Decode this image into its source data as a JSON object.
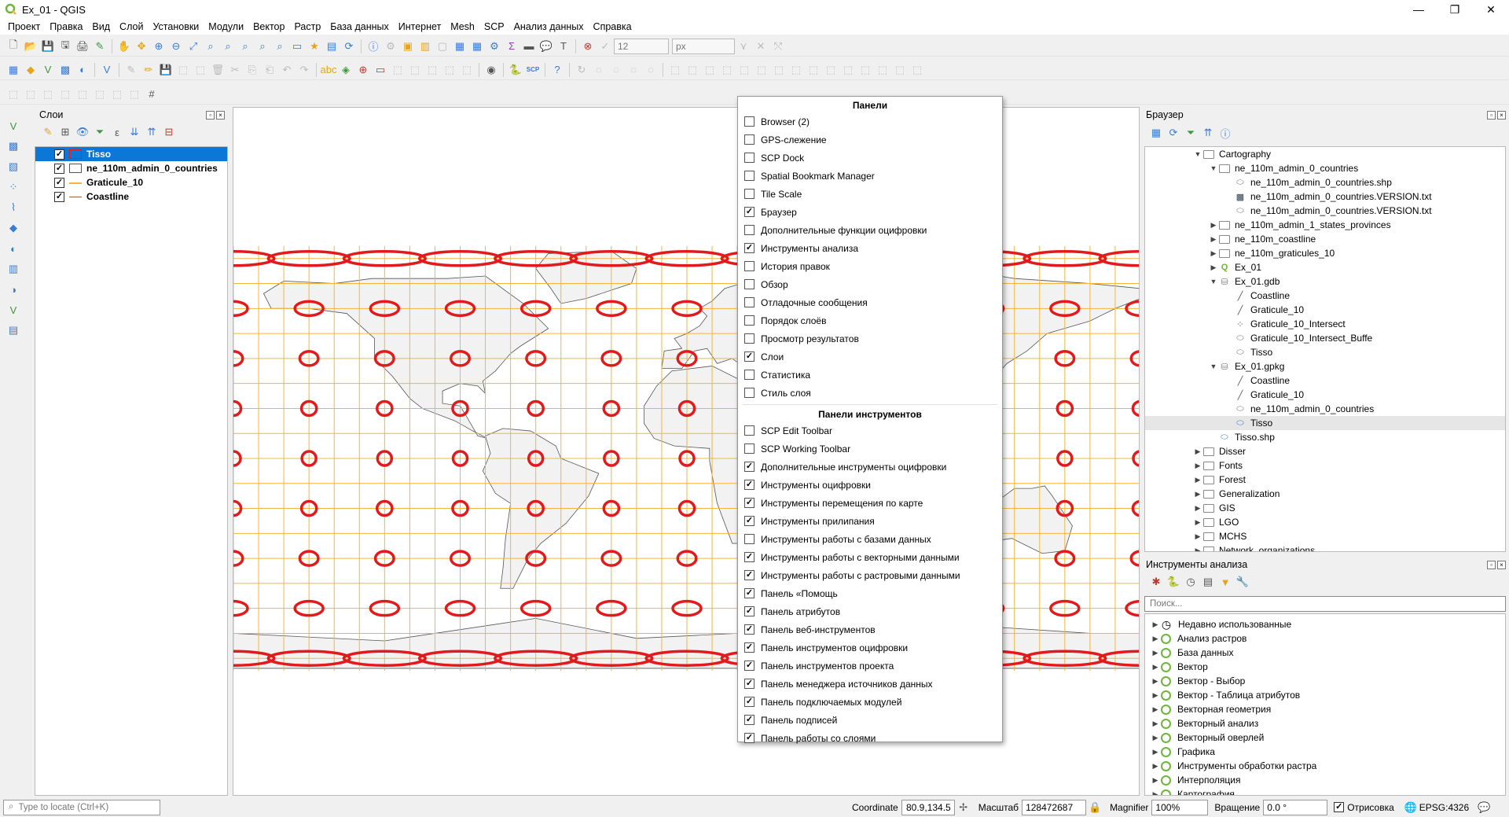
{
  "window": {
    "title": "Ex_01 - QGIS",
    "minimize": "—",
    "maximize": "❐",
    "close": "✕"
  },
  "menu": [
    "Проект",
    "Правка",
    "Вид",
    "Слой",
    "Установки",
    "Модули",
    "Вектор",
    "Растр",
    "База данных",
    "Интернет",
    "Mesh",
    "SCP",
    "Анализ данных",
    "Справка"
  ],
  "toolbar": {
    "size_value": "12",
    "unit_value": "px"
  },
  "layers_panel": {
    "title": "Слои",
    "items": [
      {
        "name": "Tisso",
        "checked": true,
        "selected": true
      },
      {
        "name": "ne_110m_admin_0_countries",
        "checked": true,
        "selected": false
      },
      {
        "name": "Graticule_10",
        "checked": true,
        "selected": false
      },
      {
        "name": "Coastline",
        "checked": true,
        "selected": false
      }
    ]
  },
  "popup": {
    "section_panels": "Панели",
    "panels": [
      {
        "label": "Browser (2)",
        "checked": false
      },
      {
        "label": "GPS-слежение",
        "checked": false
      },
      {
        "label": "SCP Dock",
        "checked": false
      },
      {
        "label": "Spatial Bookmark Manager",
        "checked": false
      },
      {
        "label": "Tile Scale",
        "checked": false
      },
      {
        "label": "Браузер",
        "checked": true
      },
      {
        "label": "Дополнительные функции оцифровки",
        "checked": false
      },
      {
        "label": "Инструменты анализа",
        "checked": true
      },
      {
        "label": "История правок",
        "checked": false
      },
      {
        "label": "Обзор",
        "checked": false
      },
      {
        "label": "Отладочные сообщения",
        "checked": false
      },
      {
        "label": "Порядок слоёв",
        "checked": false
      },
      {
        "label": "Просмотр результатов",
        "checked": false
      },
      {
        "label": "Слои",
        "checked": true
      },
      {
        "label": "Статистика",
        "checked": false
      },
      {
        "label": "Стиль слоя",
        "checked": false
      }
    ],
    "section_toolbars": "Панели инструментов",
    "toolbars": [
      {
        "label": "SCP Edit Toolbar",
        "checked": false
      },
      {
        "label": "SCP Working Toolbar",
        "checked": false
      },
      {
        "label": "Дополнительные инструменты оцифровки",
        "checked": true
      },
      {
        "label": "Инструменты оцифровки",
        "checked": true
      },
      {
        "label": "Инструменты перемещения по карте",
        "checked": true
      },
      {
        "label": "Инструменты прилипания",
        "checked": true
      },
      {
        "label": "Инструменты работы с базами данных",
        "checked": false
      },
      {
        "label": "Инструменты работы с векторными данными",
        "checked": true
      },
      {
        "label": "Инструменты работы с растровыми данными",
        "checked": true
      },
      {
        "label": "Панель «Помощь",
        "checked": true
      },
      {
        "label": "Панель атрибутов",
        "checked": true
      },
      {
        "label": "Панель веб-инструментов",
        "checked": true
      },
      {
        "label": "Панель инструментов оцифровки",
        "checked": true
      },
      {
        "label": "Панель инструментов проекта",
        "checked": true
      },
      {
        "label": "Панель менеджера источников данных",
        "checked": true
      },
      {
        "label": "Панель подключаемых модулей",
        "checked": true
      },
      {
        "label": "Панель подписей",
        "checked": true
      },
      {
        "label": "Панель работы со слоями",
        "checked": true
      }
    ]
  },
  "browser_panel": {
    "title": "Браузер",
    "items": [
      {
        "level": 3,
        "arrow": "▼",
        "icon": "folder",
        "label": "Cartography"
      },
      {
        "level": 4,
        "arrow": "▼",
        "icon": "folder",
        "label": "ne_110m_admin_0_countries"
      },
      {
        "level": 5,
        "arrow": "",
        "icon": "polygon",
        "label": "ne_110m_admin_0_countries.shp"
      },
      {
        "level": 5,
        "arrow": "",
        "icon": "raster",
        "label": "ne_110m_admin_0_countries.VERSION.txt"
      },
      {
        "level": 5,
        "arrow": "",
        "icon": "polygon",
        "label": "ne_110m_admin_0_countries.VERSION.txt"
      },
      {
        "level": 4,
        "arrow": "▶",
        "icon": "folder",
        "label": "ne_110m_admin_1_states_provinces"
      },
      {
        "level": 4,
        "arrow": "▶",
        "icon": "folder",
        "label": "ne_110m_coastline"
      },
      {
        "level": 4,
        "arrow": "▶",
        "icon": "folder",
        "label": "ne_110m_graticules_10"
      },
      {
        "level": 4,
        "arrow": "▶",
        "icon": "qgis",
        "label": "Ex_01"
      },
      {
        "level": 4,
        "arrow": "▼",
        "icon": "db",
        "label": "Ex_01.gdb"
      },
      {
        "level": 5,
        "arrow": "",
        "icon": "line",
        "label": "Coastline"
      },
      {
        "level": 5,
        "arrow": "",
        "icon": "line",
        "label": "Graticule_10"
      },
      {
        "level": 5,
        "arrow": "",
        "icon": "point",
        "label": "Graticule_10_Intersect"
      },
      {
        "level": 5,
        "arrow": "",
        "icon": "polygon",
        "label": "Graticule_10_Intersect_Buffe"
      },
      {
        "level": 5,
        "arrow": "",
        "icon": "polygon",
        "label": "Tisso"
      },
      {
        "level": 4,
        "arrow": "▼",
        "icon": "db",
        "label": "Ex_01.gpkg"
      },
      {
        "level": 5,
        "arrow": "",
        "icon": "line",
        "label": "Coastline"
      },
      {
        "level": 5,
        "arrow": "",
        "icon": "line",
        "label": "Graticule_10"
      },
      {
        "level": 5,
        "arrow": "",
        "icon": "polygon",
        "label": "ne_110m_admin_0_countries"
      },
      {
        "level": 5,
        "arrow": "",
        "icon": "polygon-blue",
        "label": "Tisso",
        "selected": true
      },
      {
        "level": 4,
        "arrow": "",
        "icon": "polygon-blue",
        "label": "Tisso.shp"
      },
      {
        "level": 3,
        "arrow": "▶",
        "icon": "folder",
        "label": "Disser"
      },
      {
        "level": 3,
        "arrow": "▶",
        "icon": "folder",
        "label": "Fonts"
      },
      {
        "level": 3,
        "arrow": "▶",
        "icon": "folder",
        "label": "Forest"
      },
      {
        "level": 3,
        "arrow": "▶",
        "icon": "folder",
        "label": "Generalization"
      },
      {
        "level": 3,
        "arrow": "▶",
        "icon": "folder",
        "label": "GIS"
      },
      {
        "level": 3,
        "arrow": "▶",
        "icon": "folder",
        "label": "LGO"
      },
      {
        "level": 3,
        "arrow": "▶",
        "icon": "folder",
        "label": "MCHS"
      },
      {
        "level": 3,
        "arrow": "▶",
        "icon": "folder",
        "label": "Network_organizations"
      }
    ]
  },
  "analysis_panel": {
    "title": "Инструменты анализа",
    "search_placeholder": "Поиск...",
    "items": [
      {
        "icon": "clock",
        "label": "Недавно использованные"
      },
      {
        "icon": "qgis",
        "label": "Анализ растров"
      },
      {
        "icon": "qgis",
        "label": "База данных"
      },
      {
        "icon": "qgis",
        "label": "Вектор"
      },
      {
        "icon": "qgis",
        "label": "Вектор - Выбор"
      },
      {
        "icon": "qgis",
        "label": "Вектор - Таблица атрибутов"
      },
      {
        "icon": "qgis",
        "label": "Векторная геометрия"
      },
      {
        "icon": "qgis",
        "label": "Векторный анализ"
      },
      {
        "icon": "qgis",
        "label": "Векторный оверлей"
      },
      {
        "icon": "qgis",
        "label": "Графика"
      },
      {
        "icon": "qgis",
        "label": "Инструменты обработки растра"
      },
      {
        "icon": "qgis",
        "label": "Интерполяция"
      },
      {
        "icon": "qgis",
        "label": "Картография"
      }
    ]
  },
  "statusbar": {
    "locate_placeholder": "Type to locate (Ctrl+K)",
    "coordinate_label": "Coordinate",
    "coordinate_value": "80.9,134.5",
    "scale_label": "Масштаб",
    "scale_value": "128472687",
    "magnifier_label": "Magnifier",
    "magnifier_value": "100%",
    "rotation_label": "Вращение",
    "rotation_value": "0.0 °",
    "render_label": "Отрисовка",
    "crs_label": "EPSG:4326"
  },
  "colors": {
    "selection": "#0b78d7",
    "graticule": "#f3b53f",
    "tissot": "#e31a1c",
    "land": "#f2f2f2",
    "qgis_green": "#6fb53b"
  }
}
